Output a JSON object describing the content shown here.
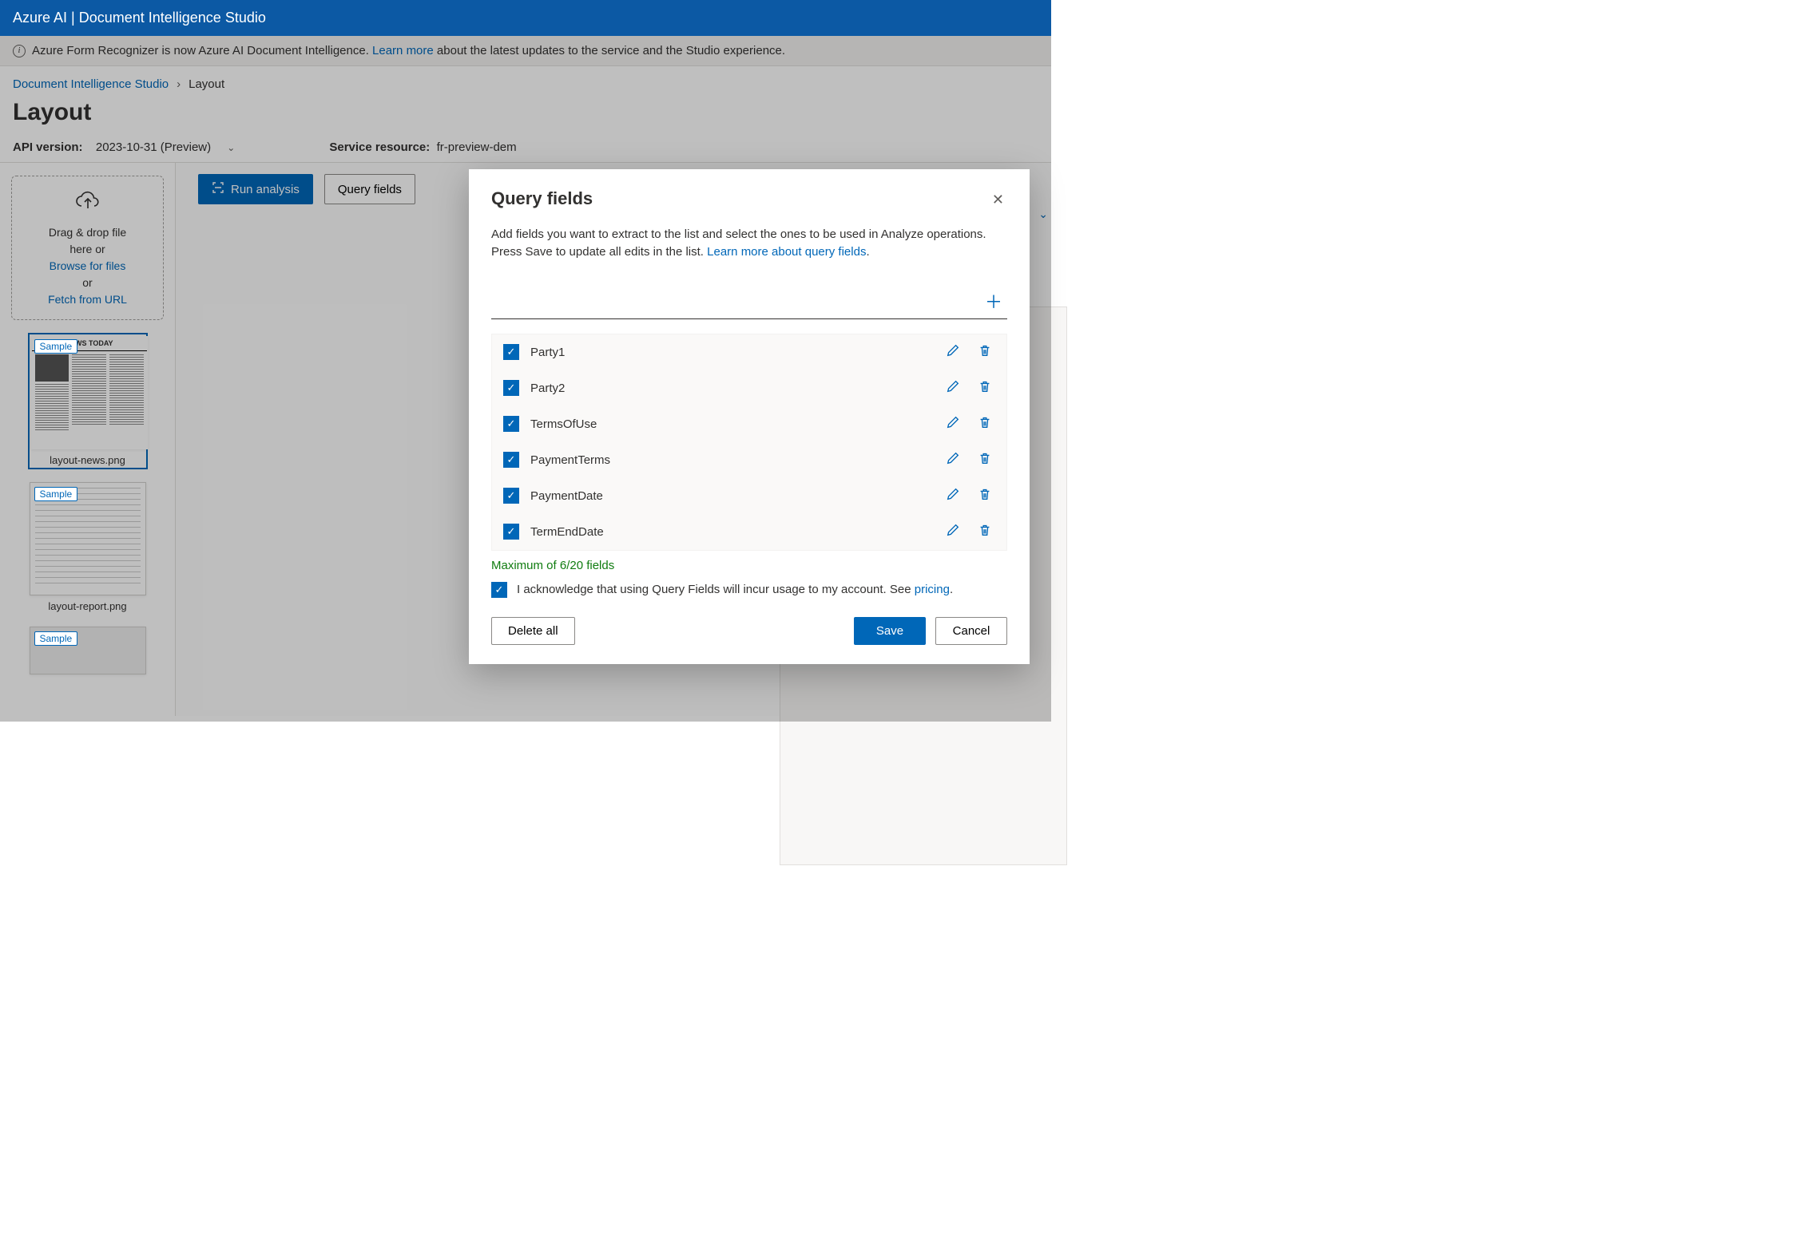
{
  "header": {
    "brand": "Azure AI | Document Intelligence Studio"
  },
  "banner": {
    "text_before": "Azure Form Recognizer is now Azure AI Document Intelligence. ",
    "link": "Learn more",
    "text_after": " about the latest updates to the service and the Studio experience."
  },
  "breadcrumb": {
    "root": "Document Intelligence Studio",
    "current": "Layout"
  },
  "page": {
    "title": "Layout"
  },
  "meta": {
    "api_label": "API version:",
    "api_value": "2023-10-31 (Preview)",
    "resource_label": "Service resource:",
    "resource_value": "fr-preview-dem"
  },
  "uploader": {
    "line1": "Drag & drop file",
    "line2": "here or",
    "browse": "Browse for files",
    "or": "or",
    "fetch": "Fetch from URL"
  },
  "thumbs": {
    "sample_badge": "Sample",
    "items": [
      {
        "caption": "layout-news.png",
        "selected": true
      },
      {
        "caption": "layout-report.png",
        "selected": false
      }
    ]
  },
  "toolbar": {
    "run": "Run analysis",
    "query": "Query fields"
  },
  "dialog": {
    "title": "Query fields",
    "desc_before": "Add fields you want to extract to the list and select the ones to be used in Analyze operations. Press Save to update all edits in the list. ",
    "desc_link": "Learn more about query fields",
    "fields": [
      {
        "name": "Party1",
        "checked": true
      },
      {
        "name": "Party2",
        "checked": true
      },
      {
        "name": "TermsOfUse",
        "checked": true
      },
      {
        "name": "PaymentTerms",
        "checked": true
      },
      {
        "name": "PaymentDate",
        "checked": true
      },
      {
        "name": "TermEndDate",
        "checked": true
      }
    ],
    "count_msg": "Maximum of 6/20 fields",
    "ack_before": "I acknowledge that using Query Fields will incur usage to my account. See ",
    "ack_link": "pricing",
    "ack_after": ".",
    "delete_all": "Delete all",
    "save": "Save",
    "cancel": "Cancel"
  }
}
